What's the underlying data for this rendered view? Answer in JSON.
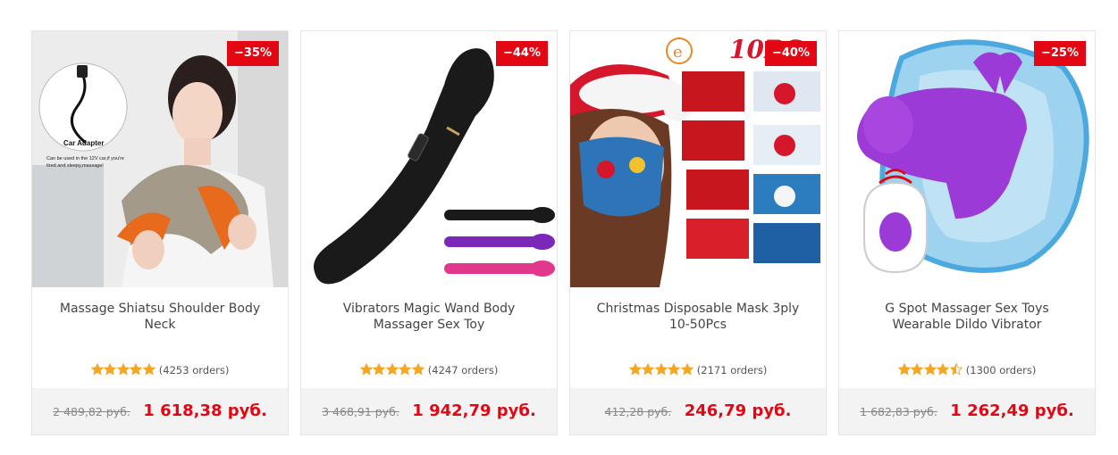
{
  "products": [
    {
      "title": "Massage Shiatsu Shoulder Body Neck",
      "discount": "−35%",
      "rating": 5,
      "orders": "(4253 orders)",
      "old_price": "2 489,82 руб.",
      "price": "1 618,38 руб.",
      "image_text": {
        "label": "Car Adapter",
        "caption_line1": "Can be used in the 12V car,if you're",
        "caption_line2": "tired and sleepy,massage!"
      }
    },
    {
      "title": "Vibrators Magic Wand Body Massager Sex Toy",
      "discount": "−44%",
      "rating": 5,
      "orders": "(4247 orders)",
      "old_price": "3 468,91 руб.",
      "price": "1 942,79 руб."
    },
    {
      "title": "Christmas Disposable Mask 3ply 10-50Pcs",
      "discount": "−40%",
      "rating": 5,
      "orders": "(2171 orders)",
      "old_price": "412,28 руб.",
      "price": "246,79 руб.",
      "image_text": {
        "logo": "e",
        "banner": "10PC"
      }
    },
    {
      "title": "G Spot Massager Sex Toys Wearable Dildo Vibrator",
      "discount": "−25%",
      "rating": 4.5,
      "orders": "(1300 orders)",
      "old_price": "1 682,83 руб.",
      "price": "1 262,49 руб."
    }
  ],
  "colors": {
    "accent": "#e30613",
    "star": "#f5a623",
    "price_bar": "#f3f3f3"
  }
}
